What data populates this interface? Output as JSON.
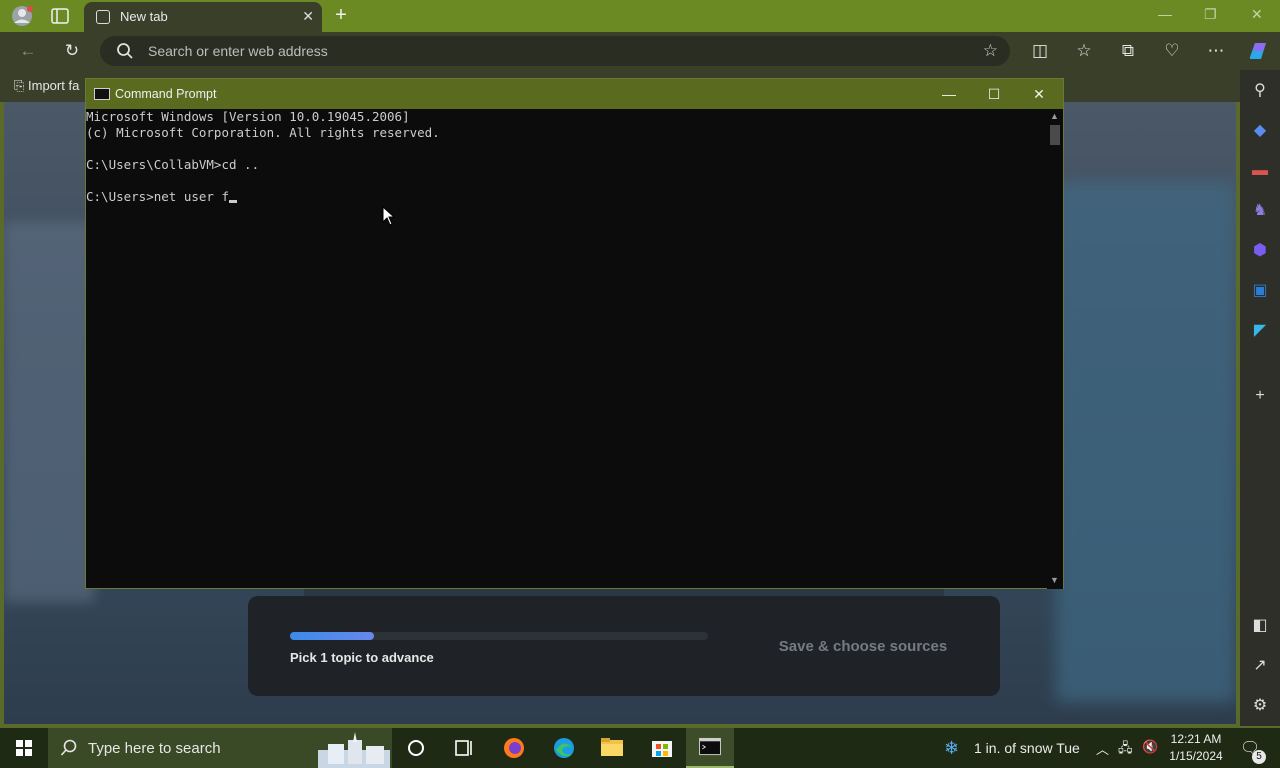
{
  "browser": {
    "tab_title": "New tab",
    "address_placeholder": "Search or enter web address",
    "favorites_bar_item": "Import fa"
  },
  "ntp": {
    "topic_progress": 0.2,
    "pick_label": "Pick 1 topic to advance",
    "save_label": "Save & choose sources"
  },
  "cmd": {
    "title": "Command Prompt",
    "lines": [
      "Microsoft Windows [Version 10.0.19045.2006]",
      "(c) Microsoft Corporation. All rights reserved.",
      "",
      "C:\\Users\\CollabVM>cd ..",
      "",
      "C:\\Users>net user f"
    ]
  },
  "taskbar": {
    "search_placeholder": "Type here to search",
    "weather": "1 in. of snow  Tue",
    "time": "12:21 AM",
    "date": "1/15/2024",
    "notification_count": "5"
  },
  "colors": {
    "browser_frame": "#6b8a24",
    "console_bg": "#0c0c0c",
    "console_text": "#cccccc",
    "progress_fill": "#3d8ef2"
  }
}
